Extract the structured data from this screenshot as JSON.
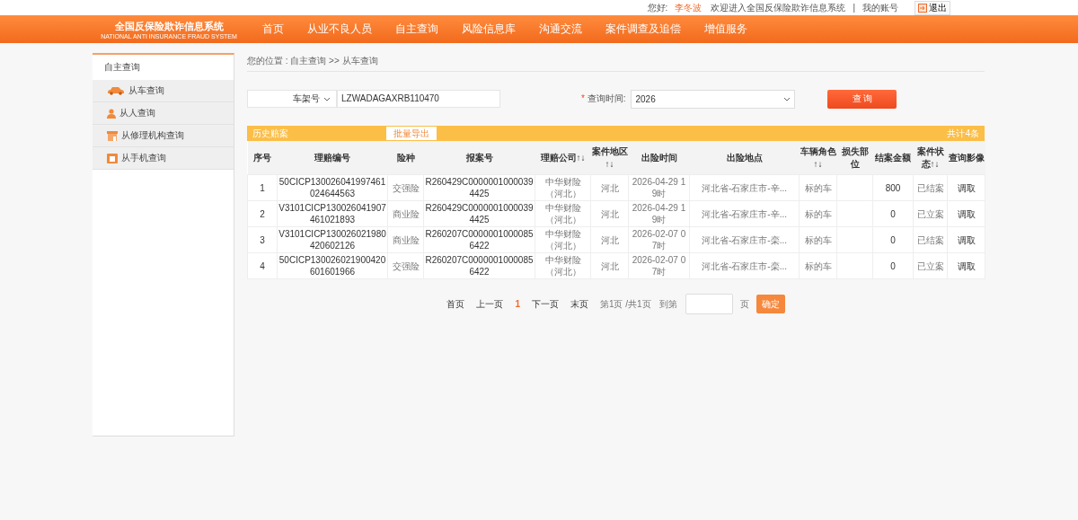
{
  "top_bar": {
    "greeting": "您好:",
    "user": "李冬波",
    "welcome": "欢迎进入全国反保险欺诈信息系统",
    "separator": "|",
    "account": "我的账号",
    "logout": "退出"
  },
  "logo": {
    "title": "全国反保险欺诈信息系统",
    "subtitle": "NATIONAL ANTI INSURANCE FRAUD SYSTEM"
  },
  "nav": [
    "首页",
    "从业不良人员",
    "自主查询",
    "风险信息库",
    "沟通交流",
    "案件调查及追偿",
    "增值服务"
  ],
  "sidebar": {
    "title": "自主查询",
    "items": [
      {
        "label": "从车查询",
        "kind": "car"
      },
      {
        "label": "从人查询",
        "kind": "person"
      },
      {
        "label": "从修理机构查询",
        "kind": "shop"
      },
      {
        "label": "从手机查询",
        "kind": "phone"
      }
    ]
  },
  "breadcrumb": "您的位置 : 自主查询 >> 从车查询",
  "search": {
    "type_select": "车架号",
    "value": "LZWADAGAXRB110470",
    "time_label_mark": "*",
    "time_label": "查询时间:",
    "time_select": "2026",
    "button": "查 询"
  },
  "table_bar": {
    "title": "历史赔案",
    "export": "批量导出",
    "total": "共计4条"
  },
  "table": {
    "columns": [
      "序号",
      "理赔编号",
      "险种",
      "报案号",
      "理赔公司↑↓",
      "案件地区↑↓",
      "出险时间",
      "出险地点",
      "车辆角色↑↓",
      "损失部位",
      "结案金额",
      "案件状态↑↓",
      "查询影像"
    ],
    "rows": [
      [
        "1",
        "50CICP130026041997461024644563",
        "交强险",
        "R260429C00000010000394425",
        "中华财险（河北）",
        "河北",
        "2026-04-29 19时",
        "河北省-石家庄市-辛...",
        "标的车",
        "",
        "800",
        "已结案",
        "调取"
      ],
      [
        "2",
        "V3101CICP130026041907461021893",
        "商业险",
        "R260429C00000010000394425",
        "中华财险（河北）",
        "河北",
        "2026-04-29 19时",
        "河北省-石家庄市-辛...",
        "标的车",
        "",
        "0",
        "已立案",
        "调取"
      ],
      [
        "3",
        "V3101CICP130026021980420602126",
        "商业险",
        "R260207C00000010000856422",
        "中华财险（河北）",
        "河北",
        "2026-02-07 07时",
        "河北省-石家庄市-栾...",
        "标的车",
        "",
        "0",
        "已结案",
        "调取"
      ],
      [
        "4",
        "50CICP130026021900420601601966",
        "交强险",
        "R260207C00000010000856422",
        "中华财险（河北）",
        "河北",
        "2026-02-07 07时",
        "河北省-石家庄市-栾...",
        "标的车",
        "",
        "0",
        "已立案",
        "调取"
      ]
    ]
  },
  "pager": [
    {
      "label": "首页",
      "kind": "link"
    },
    {
      "label": "上一页",
      "kind": "link"
    },
    {
      "label": "1",
      "kind": "current"
    },
    {
      "label": "下一页",
      "kind": "link"
    },
    {
      "label": "末页",
      "kind": "link"
    },
    {
      "label": "第1页 /共1页",
      "kind": "info"
    },
    {
      "label": "到第",
      "kind": "info"
    }
  ],
  "goto": {
    "unit": "页",
    "button": "确定"
  }
}
